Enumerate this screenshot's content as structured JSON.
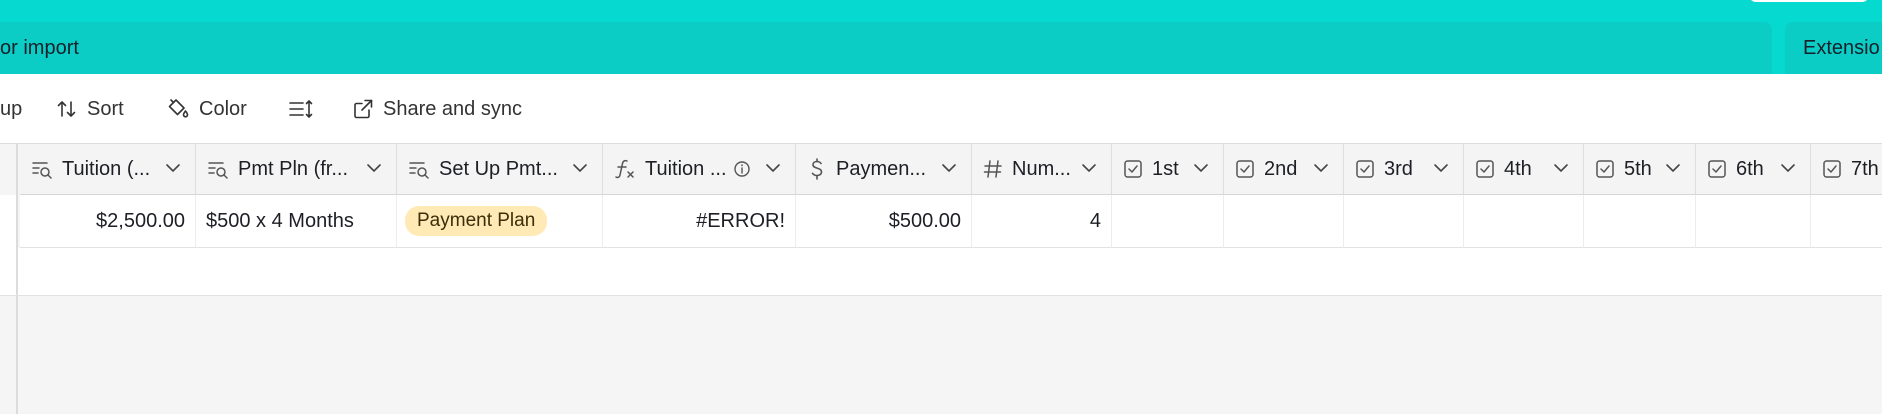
{
  "top": {
    "subbar_text": "or import",
    "extensions_label": "Extensio"
  },
  "toolbar": {
    "group_label": "up",
    "sort_label": "Sort",
    "color_label": "Color",
    "share_label": "Share and sync"
  },
  "columns": [
    {
      "label": "Tuition (...",
      "icon": "lookup-icon"
    },
    {
      "label": "Pmt Pln (fr...",
      "icon": "lookup-icon"
    },
    {
      "label": "Set Up Pmt...",
      "icon": "lookup-icon"
    },
    {
      "label": "Tuition ...",
      "icon": "formula-icon"
    },
    {
      "label": "Paymen...",
      "icon": "currency-icon"
    },
    {
      "label": "Num...",
      "icon": "number-icon"
    },
    {
      "label": "1st",
      "icon": "checkbox-icon"
    },
    {
      "label": "2nd",
      "icon": "checkbox-icon"
    },
    {
      "label": "3rd",
      "icon": "checkbox-icon"
    },
    {
      "label": "4th",
      "icon": "checkbox-icon"
    },
    {
      "label": "5th",
      "icon": "checkbox-icon"
    },
    {
      "label": "6th",
      "icon": "checkbox-icon"
    },
    {
      "label": "7th",
      "icon": "checkbox-icon"
    }
  ],
  "row": {
    "tuition": "$2,500.00",
    "pmt_pln": "$500 x 4 Months",
    "set_up_pmt": "Payment Plan",
    "tuition_formula": "#ERROR!",
    "payment": "$500.00",
    "num": "4"
  },
  "colors": {
    "teal": "#06d9d0",
    "teal_dark": "#0bcdc5",
    "pill_yellow": "#ffeab6"
  }
}
